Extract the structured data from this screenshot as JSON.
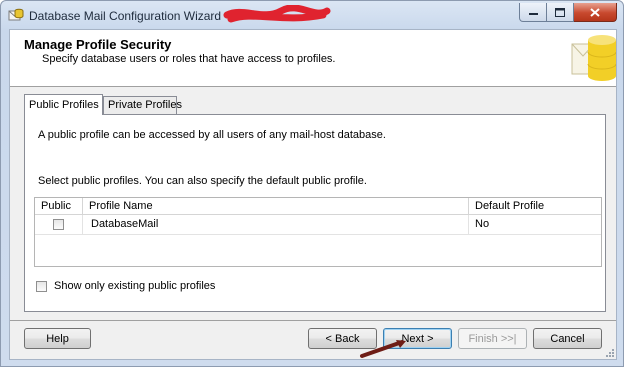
{
  "window": {
    "title": "Database Mail Configuration Wizard -",
    "minimize_glyph": "–",
    "maximize_glyph": "□",
    "close_glyph": "✕"
  },
  "header": {
    "title": "Manage Profile Security",
    "subtitle": "Specify database users or roles that have access to profiles."
  },
  "tabs": [
    {
      "label": "Public Profiles",
      "active": true
    },
    {
      "label": "Private Profiles",
      "active": false
    }
  ],
  "panel": {
    "description": "A public profile can be accessed by all users of any mail-host database.",
    "instruction": "Select public profiles. You can also specify the default public profile."
  },
  "grid": {
    "columns": [
      "Public",
      "Profile Name",
      "Default Profile"
    ],
    "rows": [
      {
        "public": false,
        "profile_name": "DatabaseMail",
        "default_profile": "No"
      }
    ]
  },
  "show_existing": {
    "label": "Show only existing public profiles",
    "checked": false
  },
  "buttons": {
    "help": "Help",
    "back": "< Back",
    "next": "Next >",
    "finish": "Finish >>|",
    "cancel": "Cancel"
  },
  "colors": {
    "title_bar": "#cfdcee",
    "close_button": "#c8492e",
    "annotation_arrow": "#6e1d16"
  }
}
